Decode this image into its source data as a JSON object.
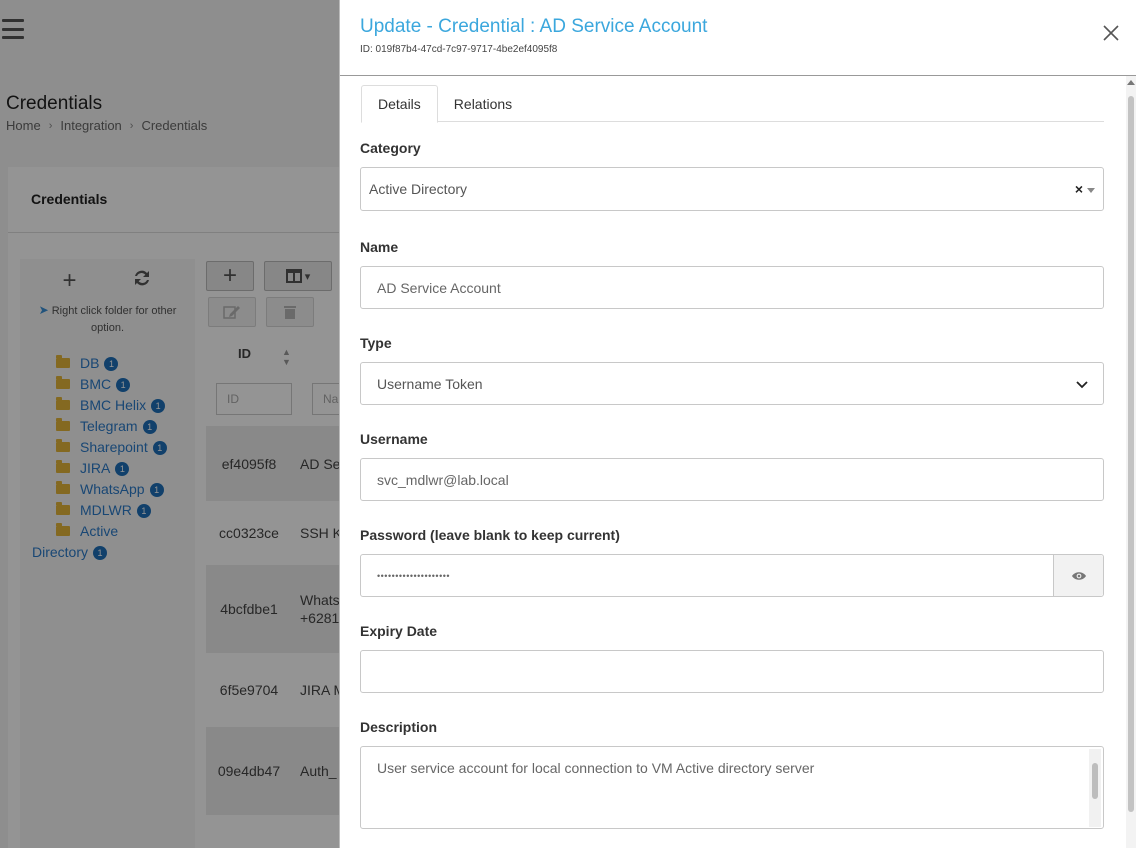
{
  "background": {
    "page_title": "Credentials",
    "breadcrumb": [
      "Home",
      "Integration",
      "Credentials"
    ],
    "card_title": "Credentials",
    "tree_hint": "Right click folder for other option.",
    "folders": [
      {
        "name": "DB",
        "count": "1"
      },
      {
        "name": "BMC",
        "count": "1"
      },
      {
        "name": "BMC Helix",
        "count": "1"
      },
      {
        "name": "Telegram",
        "count": "1"
      },
      {
        "name": "Sharepoint",
        "count": "1"
      },
      {
        "name": "JIRA",
        "count": "1"
      },
      {
        "name": "WhatsApp",
        "count": "1"
      },
      {
        "name": "MDLWR",
        "count": "1"
      },
      {
        "name": "Active",
        "count": ""
      }
    ],
    "folder_tail": {
      "name": "Directory",
      "count": "1"
    },
    "grid_header_id": "ID",
    "filter_id_placeholder": "ID",
    "filter_name_placeholder": "Na",
    "rows": [
      {
        "id": "ef4095f8",
        "name": "AD Se"
      },
      {
        "id": "cc0323ce",
        "name": "SSH K"
      },
      {
        "id": "4bcfdbe1",
        "name": "Whats",
        "name2": "+6281"
      },
      {
        "id": "6f5e9704",
        "name": "JIRA M"
      },
      {
        "id": "09e4db47",
        "name": "Auth_"
      }
    ]
  },
  "modal": {
    "title": "Update - Credential : AD Service Account",
    "id_line": "ID: 019f87b4-47cd-7c97-9717-4be2ef4095f8",
    "tabs": [
      "Details",
      "Relations"
    ],
    "category": {
      "label": "Category",
      "value": "Active Directory",
      "clear": "×"
    },
    "name": {
      "label": "Name",
      "value": "AD Service Account"
    },
    "type": {
      "label": "Type",
      "value": "Username Token"
    },
    "username": {
      "label": "Username",
      "value": "svc_mdlwr@lab.local"
    },
    "password": {
      "label": "Password (leave blank to keep current)",
      "value": "••••••••••••••••••••"
    },
    "expiry": {
      "label": "Expiry Date",
      "value": ""
    },
    "description": {
      "label": "Description",
      "value": "User service account for local connection to VM Active directory server"
    }
  },
  "colors": {
    "title_accent": "#3ba7dd",
    "folder": "#e3b53a",
    "badge": "#1e6fb8"
  }
}
